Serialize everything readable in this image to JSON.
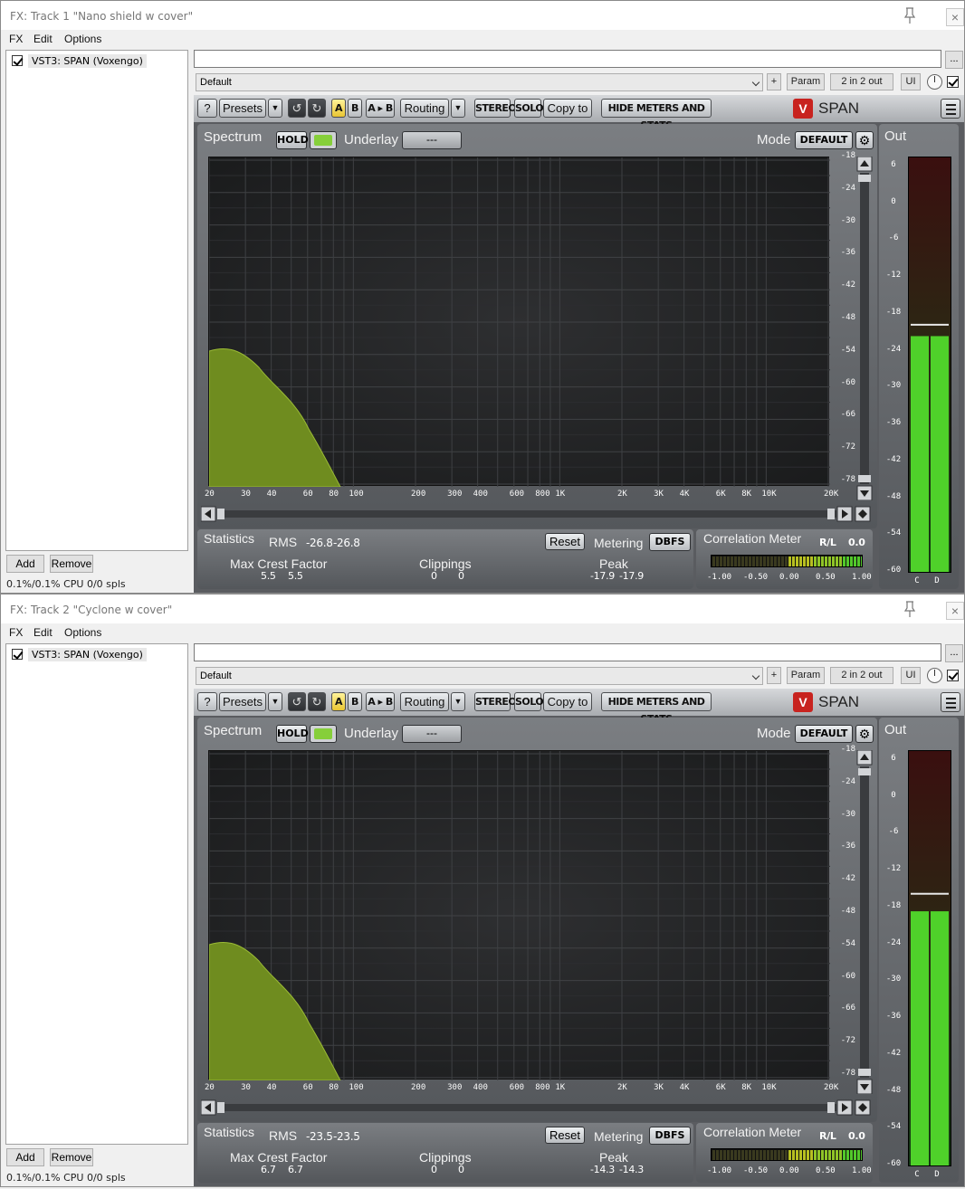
{
  "colors": {
    "spectrum_fill": "#6f8c1f",
    "meter_green": "#4fd12a",
    "logo_red": "#c8231f"
  },
  "windows": [
    {
      "title": "FX: Track 1 \"Nano shield w cover\"",
      "menu": [
        "FX",
        "Edit",
        "Options"
      ],
      "fx_item": "VST3: SPAN (Voxengo)",
      "add_label": "Add",
      "remove_label": "Remove",
      "cpu": "0.1%/0.1% CPU 0/0 spls",
      "preset_value": "Default",
      "plus_label": "+",
      "param_label": "Param",
      "io_label": "2 in 2 out",
      "ui_label": "UI",
      "dots_label": "...",
      "toolbar": {
        "help": "?",
        "presets": "Presets",
        "a": "A",
        "b": "B",
        "ab": "A ▸ B",
        "routing": "Routing",
        "stereo": "STEREO",
        "solo": "SOLO",
        "copy": "Copy to",
        "hide": "HIDE METERS AND STATS",
        "logo": "SPAN"
      },
      "spectrum": {
        "label": "Spectrum",
        "hold": "HOLD",
        "underlay": "Underlay",
        "underlay_value": "---",
        "mode": "Mode",
        "mode_value": "DEFAULT"
      },
      "statistics": {
        "label": "Statistics",
        "rms_label": "RMS",
        "rms_l": "-26.8",
        "rms_r": "-26.8",
        "reset": "Reset",
        "metering": "Metering",
        "metering_value": "DBFS",
        "crest_label": "Max Crest Factor",
        "crest_l": "5.5",
        "crest_r": "5.5",
        "clip_label": "Clippings",
        "clip_l": "0",
        "clip_r": "0",
        "peak_label": "Peak",
        "peak_l": "-17.9",
        "peak_r": "-17.9"
      },
      "correlation": {
        "label": "Correlation Meter",
        "rl": "R/L",
        "value": "0.0"
      },
      "out": {
        "label": "Out",
        "level_db": -22.5,
        "peak_db": -20.5
      }
    },
    {
      "title": "FX: Track 2 \"Cyclone w cover\"",
      "menu": [
        "FX",
        "Edit",
        "Options"
      ],
      "fx_item": "VST3: SPAN (Voxengo)",
      "add_label": "Add",
      "remove_label": "Remove",
      "cpu": "0.1%/0.1% CPU 0/0 spls",
      "preset_value": "Default",
      "plus_label": "+",
      "param_label": "Param",
      "io_label": "2 in 2 out",
      "ui_label": "UI",
      "dots_label": "...",
      "toolbar": {
        "help": "?",
        "presets": "Presets",
        "a": "A",
        "b": "B",
        "ab": "A ▸ B",
        "routing": "Routing",
        "stereo": "STEREO",
        "solo": "SOLO",
        "copy": "Copy to",
        "hide": "HIDE METERS AND STATS",
        "logo": "SPAN"
      },
      "spectrum": {
        "label": "Spectrum",
        "hold": "HOLD",
        "underlay": "Underlay",
        "underlay_value": "---",
        "mode": "Mode",
        "mode_value": "DEFAULT"
      },
      "statistics": {
        "label": "Statistics",
        "rms_label": "RMS",
        "rms_l": "-23.5",
        "rms_r": "-23.5",
        "reset": "Reset",
        "metering": "Metering",
        "metering_value": "DBFS",
        "crest_label": "Max Crest Factor",
        "crest_l": "6.7",
        "crest_r": "6.7",
        "clip_label": "Clippings",
        "clip_l": "0",
        "clip_r": "0",
        "peak_label": "Peak",
        "peak_l": "-14.3",
        "peak_r": "-14.3"
      },
      "correlation": {
        "label": "Correlation Meter",
        "rl": "R/L",
        "value": "0.0"
      },
      "out": {
        "label": "Out",
        "level_db": -19.5,
        "peak_db": -16.5
      }
    }
  ],
  "spectrum_axis": {
    "y_ticks": [
      "-18",
      "-24",
      "-30",
      "-36",
      "-42",
      "-48",
      "-54",
      "-60",
      "-66",
      "-72",
      "-78"
    ],
    "x_ticks": [
      "20",
      "30",
      "40",
      "60",
      "80",
      "100",
      "200",
      "300",
      "400",
      "600",
      "800",
      "1K",
      "2K",
      "3K",
      "4K",
      "6K",
      "8K",
      "10K",
      "20K"
    ]
  },
  "out_axis": [
    "6",
    "0",
    "-6",
    "-12",
    "-18",
    "-24",
    "-30",
    "-36",
    "-42",
    "-48",
    "-54",
    "-60"
  ],
  "corr_axis": [
    "-1.00",
    "-0.50",
    "0.00",
    "0.50",
    "1.00"
  ],
  "channel_labels": [
    "C",
    "D"
  ]
}
